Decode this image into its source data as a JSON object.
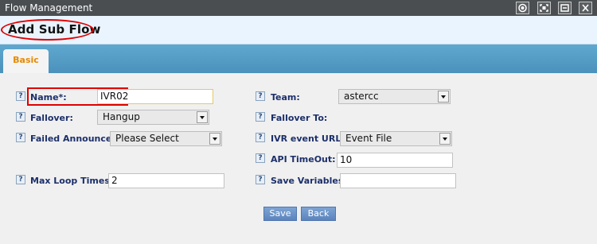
{
  "window": {
    "title": "Flow Management",
    "controls": [
      "record-icon",
      "fullscreen-icon",
      "minimize-icon",
      "close-icon"
    ]
  },
  "header": {
    "title": "Add Sub Flow"
  },
  "tabs": [
    {
      "label": "Basic",
      "active": true
    }
  ],
  "form": {
    "name": {
      "label": "Name*:",
      "value": "IVR02"
    },
    "fallover": {
      "label": "Fallover:",
      "value": "Hangup"
    },
    "failed_announce": {
      "label": "Failed Announce:",
      "value": "Please Select"
    },
    "max_loop_times": {
      "label": "Max Loop Times:",
      "value": "2"
    },
    "team": {
      "label": "Team:",
      "value": "astercc"
    },
    "fallover_to": {
      "label": "Fallover To:"
    },
    "ivr_event_url": {
      "label": "IVR event URL:",
      "value": "Event File"
    },
    "api_timeout": {
      "label": "API TimeOut:",
      "value": "10"
    },
    "save_variables": {
      "label": "Save Variables:",
      "value": ""
    }
  },
  "help_glyph": "?",
  "actions": {
    "save": "Save",
    "back": "Back"
  },
  "colors": {
    "highlight": "#e00000",
    "accent_tab": "#e68a00",
    "label": "#1c2f6a",
    "tab_bar": "#4a92bb"
  }
}
